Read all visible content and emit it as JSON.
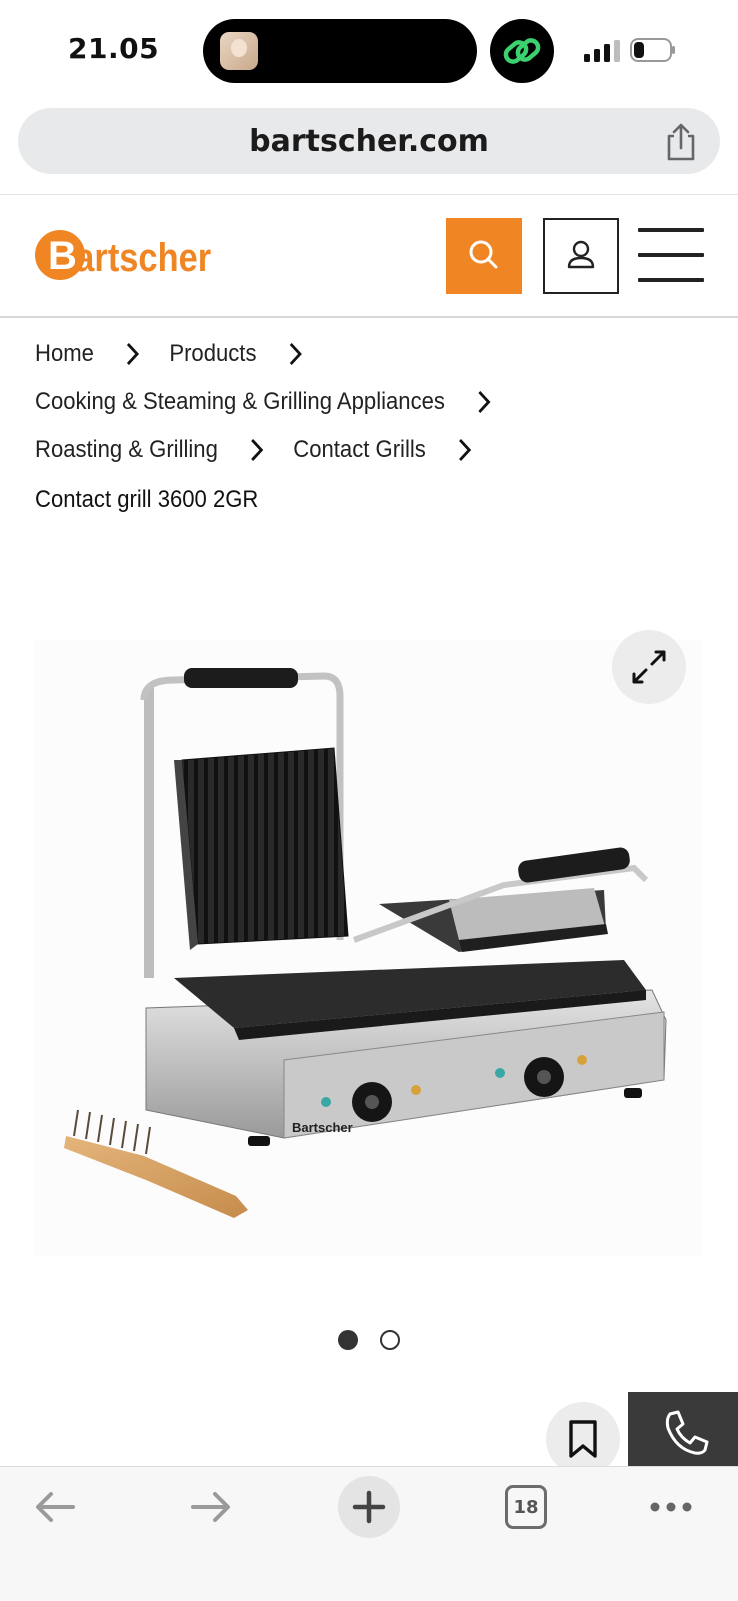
{
  "status_bar": {
    "time": "21.05"
  },
  "browser": {
    "url": "bartscher.com",
    "open_tabs": "18"
  },
  "site": {
    "brand": "Bartscher",
    "colors": {
      "accent": "#f08524",
      "dark": "#222222"
    }
  },
  "breadcrumb": {
    "items": [
      "Home",
      "Products",
      "Cooking & Steaming & Grilling Appliances",
      "Roasting & Grilling",
      "Contact Grills"
    ],
    "current": "Contact grill 3600 2GR"
  },
  "product_gallery": {
    "image_subject": "double contact grill with wire brush",
    "brand_on_device": "Bartscher",
    "slides": 2,
    "active_slide": 1
  },
  "icons": {
    "share": "share-icon",
    "search": "search-icon",
    "account": "user-icon",
    "menu": "hamburger-icon",
    "expand": "expand-icon",
    "bookmark": "bookmark-icon",
    "phone": "phone-icon",
    "back": "back-arrow-icon",
    "forward": "forward-arrow-icon",
    "new_tab": "plus-icon",
    "more": "more-icon"
  }
}
